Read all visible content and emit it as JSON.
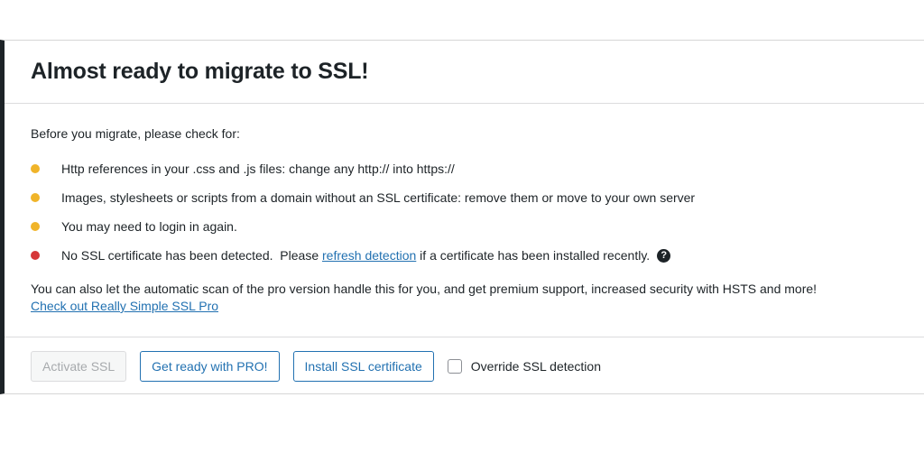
{
  "notice": {
    "title": "Almost ready to migrate to SSL!",
    "intro": "Before you migrate, please check for:",
    "items": [
      {
        "status": "warning",
        "text": "Http references in your .css and .js files: change any http:// into https://"
      },
      {
        "status": "warning",
        "text": "Images, stylesheets or scripts from a domain without an SSL certificate: remove them or move to your own server"
      },
      {
        "status": "warning",
        "text": "You may need to login in again."
      },
      {
        "status": "error",
        "text_before": "No SSL certificate has been detected.  Please ",
        "link": "refresh detection",
        "text_after": " if a certificate has been installed recently.",
        "help_icon": "?"
      }
    ],
    "pro_text": "You can also let the automatic scan of the pro version handle this for you, and get premium support, increased security with HSTS and more!",
    "pro_link": "Check out Really Simple SSL Pro"
  },
  "actions": {
    "activate_label": "Activate SSL",
    "pro_label": "Get ready with PRO!",
    "install_label": "Install SSL certificate",
    "override_label": "Override SSL detection",
    "override_checked": false
  },
  "colors": {
    "warning": "#f0b429",
    "error": "#d63638",
    "link": "#2271b1",
    "left_border": "#1d2327"
  }
}
